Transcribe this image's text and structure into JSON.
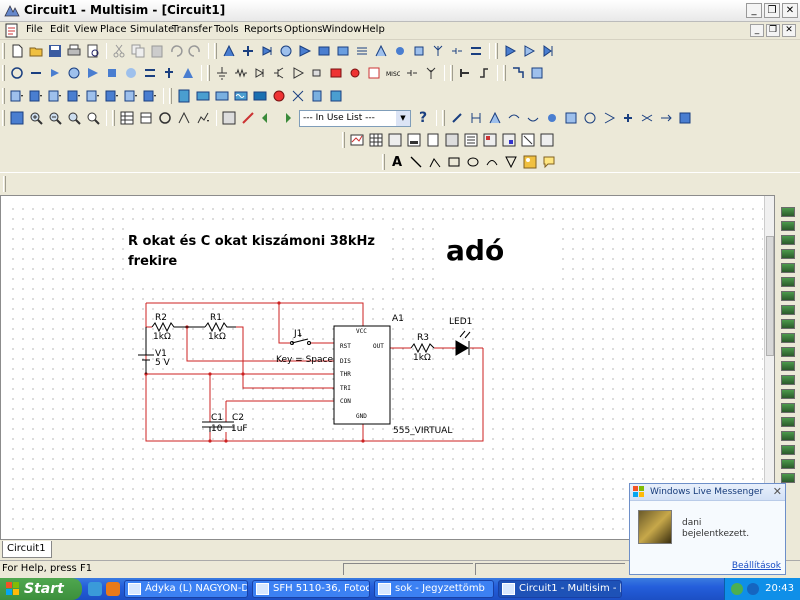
{
  "window": {
    "title": "Circuit1 - Multisim - [Circuit1]"
  },
  "menu": [
    "File",
    "Edit",
    "View",
    "Place",
    "Simulate",
    "Transfer",
    "Tools",
    "Reports",
    "Options",
    "Window",
    "Help"
  ],
  "toolbar": {
    "in_use_combo": "--- In Use List ---",
    "help_glyph": "?",
    "text_tool": "A"
  },
  "notes": {
    "line1": "R okat és C okat kiszámoni 38kHz",
    "line2": "frekire",
    "big": "adó"
  },
  "schematic": {
    "r2": {
      "name": "R2",
      "value": "1kΩ"
    },
    "r1": {
      "name": "R1",
      "value": "1kΩ"
    },
    "v1": {
      "name": "V1",
      "value": "5 V"
    },
    "j1": {
      "name": "J1",
      "key": "Key = Space"
    },
    "ic": {
      "name": "A1",
      "model": "555_VIRTUAL",
      "pins": [
        "VCC",
        "RST",
        "OUT",
        "DIS",
        "THR",
        "TRI",
        "CON",
        "GND"
      ]
    },
    "r3": {
      "name": "R3",
      "value": "1kΩ"
    },
    "led": {
      "name": "LED1"
    },
    "c1": {
      "name": "C1",
      "value": "10"
    },
    "c2": {
      "name": "C2",
      "value": "1uF"
    }
  },
  "document_tab": "Circuit1",
  "status": {
    "help": "For Help, press F1"
  },
  "taskbar": {
    "start": "Start",
    "tasks": [
      "Ádyka (L) NAGYON-D...",
      "SFH 5110-36, Fotodi...",
      "sok - Jegyzettömb",
      "Circuit1 - Multisim - [C..."
    ],
    "clock": "20:43"
  },
  "toast": {
    "app": "Windows Live Messenger",
    "user": "dani",
    "message": "bejelentkezett.",
    "options": "Beállítások",
    "close": "✕"
  },
  "colors": {
    "wire": "#cc2222",
    "grid": "#888888",
    "taskbar": "#245edb",
    "start": "#3c8f3c"
  }
}
